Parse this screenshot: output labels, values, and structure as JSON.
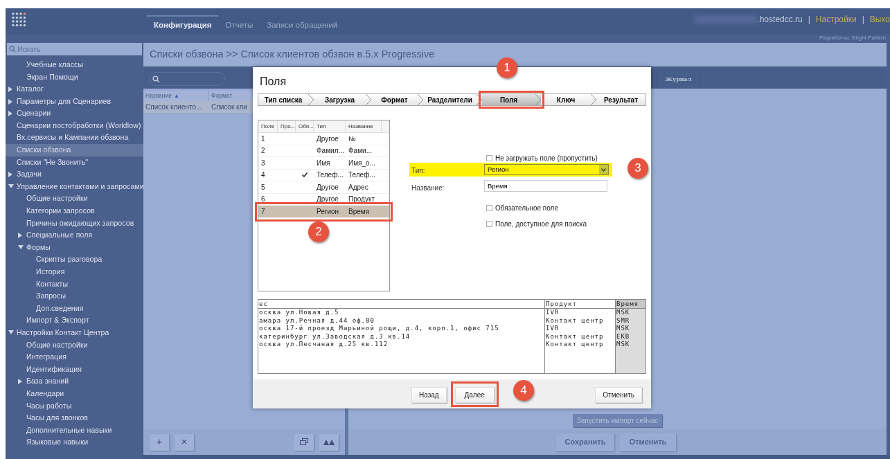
{
  "header": {
    "nav": [
      {
        "label": "Конфигурация",
        "selected": true
      },
      {
        "label": "Отчеты",
        "selected": false
      },
      {
        "label": "Записи обращений",
        "selected": false
      }
    ],
    "account": ".hostedcc.ru",
    "separators": [
      "|",
      "|"
    ],
    "settings_link": "Настройки",
    "logout_link": "Выхо",
    "credit": "Разработка: Bright Pattern"
  },
  "sidebar": {
    "search": {
      "placeholder": "Искать"
    },
    "continued_items": [
      {
        "label": "Учебные классы",
        "selected": false
      },
      {
        "label": "Экран Помощи",
        "selected": false
      }
    ],
    "items": [
      {
        "label": "Каталог",
        "expanded": false,
        "selected": false
      },
      {
        "label": "Параметры для Сценариев",
        "expanded": false,
        "selected": false
      },
      {
        "label": "Сценарии",
        "expanded": false,
        "selected": false
      },
      {
        "label": "Сценарии постобработки (Workflow)",
        "selected": false
      },
      {
        "label": "Вх.сервисы и Кампании обзвона",
        "selected": false
      },
      {
        "label": "Списки обзвона",
        "selected": true
      },
      {
        "label": "Списки \"Не Звонить\"",
        "selected": false
      },
      {
        "label": "Задачи",
        "expanded": false,
        "selected": false
      },
      {
        "label": "Управление контактами и запросами",
        "expanded": true,
        "selected": false,
        "children": [
          {
            "label": "Общие настройки",
            "selected": false
          },
          {
            "label": "Категории запросов",
            "selected": false
          },
          {
            "label": "Причины ожидающих запросов",
            "selected": false
          },
          {
            "label": "Специальные поля",
            "expanded": false,
            "selected": false
          },
          {
            "label": "Формы",
            "expanded": true,
            "selected": false,
            "children": [
              {
                "label": "Скрипты разговора",
                "selected": false
              },
              {
                "label": "История",
                "selected": false
              },
              {
                "label": "Контакты",
                "selected": false
              },
              {
                "label": "Запросы",
                "selected": false
              },
              {
                "label": "Доп.сведения",
                "selected": false
              }
            ]
          },
          {
            "label": "Импорт & Экспорт",
            "selected": false
          }
        ]
      },
      {
        "label": "Настройки Контакт Центра",
        "expanded": true,
        "selected": false,
        "children": [
          {
            "label": "Общие настройки",
            "selected": false
          },
          {
            "label": "Интеграция",
            "selected": false
          },
          {
            "label": "Идентификация",
            "selected": false
          },
          {
            "label": "База знаний",
            "expanded": false,
            "selected": false
          },
          {
            "label": "Календари",
            "selected": false
          },
          {
            "label": "Часы работы",
            "selected": false
          },
          {
            "label": "Часы для звонков",
            "selected": false
          },
          {
            "label": "Дополнительные навыки",
            "selected": false
          },
          {
            "label": "Языковые навыки",
            "selected": false
          }
        ]
      }
    ]
  },
  "page_title": "Списки обзвона >> Список клиентов обзвон в.5.x Progressive",
  "list": {
    "columns": [
      {
        "label": "Название",
        "sort_mark": "▲"
      },
      {
        "label": "Формат"
      }
    ],
    "rows": [
      {
        "cells": [
          "Список клиенто...",
          "Список кли"
        ],
        "selected": true
      }
    ],
    "buttons": [
      "+",
      "×"
    ]
  },
  "detail": {
    "tabs": [
      {
        "label": "Журнал",
        "selected": false
      }
    ],
    "run_import_button": "Запустить импорт сейчас",
    "save_button": "Сохранить",
    "cancel_button": "Отменить"
  },
  "dialog": {
    "title": "Поля",
    "steps": [
      {
        "label": "Тип списка",
        "selected": false,
        "annotated": false
      },
      {
        "label": "Загрузка",
        "selected": false,
        "annotated": false
      },
      {
        "label": "Формат",
        "selected": false,
        "annotated": false
      },
      {
        "label": "Разделители",
        "selected": false,
        "annotated": false
      },
      {
        "label": "Поля",
        "selected": true,
        "annotated": true
      },
      {
        "label": "Ключ",
        "selected": false,
        "annotated": false
      },
      {
        "label": "Результат",
        "selected": false,
        "annotated": false
      }
    ],
    "fields_table": {
      "columns": [
        "Поле",
        "Про...",
        "Обя...",
        "Тип",
        "Название"
      ],
      "rows": [
        {
          "field": "1",
          "required": false,
          "type": "Другое",
          "name": "№",
          "selected": false,
          "annotated": false
        },
        {
          "field": "2",
          "required": false,
          "type": "Фамил...",
          "name": "Фами...",
          "selected": false,
          "annotated": false
        },
        {
          "field": "3",
          "required": false,
          "type": "Имя",
          "name": "Имя_о...",
          "selected": false,
          "annotated": false
        },
        {
          "field": "4",
          "required": true,
          "type": "Телеф...",
          "name": "Телеф...",
          "selected": false,
          "annotated": false
        },
        {
          "field": "5",
          "required": false,
          "type": "Другое",
          "name": "Адрес",
          "selected": false,
          "annotated": false
        },
        {
          "field": "6",
          "required": false,
          "type": "Другое",
          "name": "Продукт",
          "selected": false,
          "annotated": false
        },
        {
          "field": "7",
          "required": false,
          "type": "Регион",
          "name": "Время",
          "selected": true,
          "annotated": true
        }
      ]
    },
    "skip_checkbox": {
      "label": "Не загружать поле (пропустить)",
      "checked": false
    },
    "type_field": {
      "label": "Тип:",
      "value": "Регион",
      "highlighted": true
    },
    "name_field": {
      "label": "Название:",
      "value": "Время"
    },
    "required_checkbox": {
      "label": "Обязательное поле",
      "checked": false
    },
    "searchable_checkbox": {
      "label": "Поле, доступное для поиска",
      "checked": false
    },
    "preview": {
      "columns": [
        {
          "label": "ес",
          "selected": false
        },
        {
          "label": "Продукт",
          "selected": false
        },
        {
          "label": "Время",
          "selected": true
        }
      ],
      "rows": [
        [
          "осква ул.Новая д.5",
          "IVR",
          "MSK"
        ],
        [
          "амара ул.Речная д.44 оф.80",
          "Контакт центр",
          "SMR"
        ],
        [
          "осква 17-й проезд Марьиной рощи, д.4, корп.1, офис 715",
          "IVR",
          "MSK"
        ],
        [
          "катеринбург ул.Заводская д.3 кв.14",
          "Контакт центр",
          "EKB"
        ],
        [
          "осква ул.Песчаная д.25 кв.112",
          "Контакт центр",
          "MSK"
        ]
      ]
    },
    "buttons": [
      {
        "label": "Назад",
        "kind": "back",
        "annotated": false
      },
      {
        "label": "Далее",
        "kind": "next",
        "annotated": true
      },
      {
        "label": "Отменить",
        "kind": "cancel",
        "annotated": false
      }
    ]
  },
  "annotations": [
    {
      "label": "1"
    },
    {
      "label": "2"
    },
    {
      "label": "3"
    },
    {
      "label": "4"
    }
  ]
}
